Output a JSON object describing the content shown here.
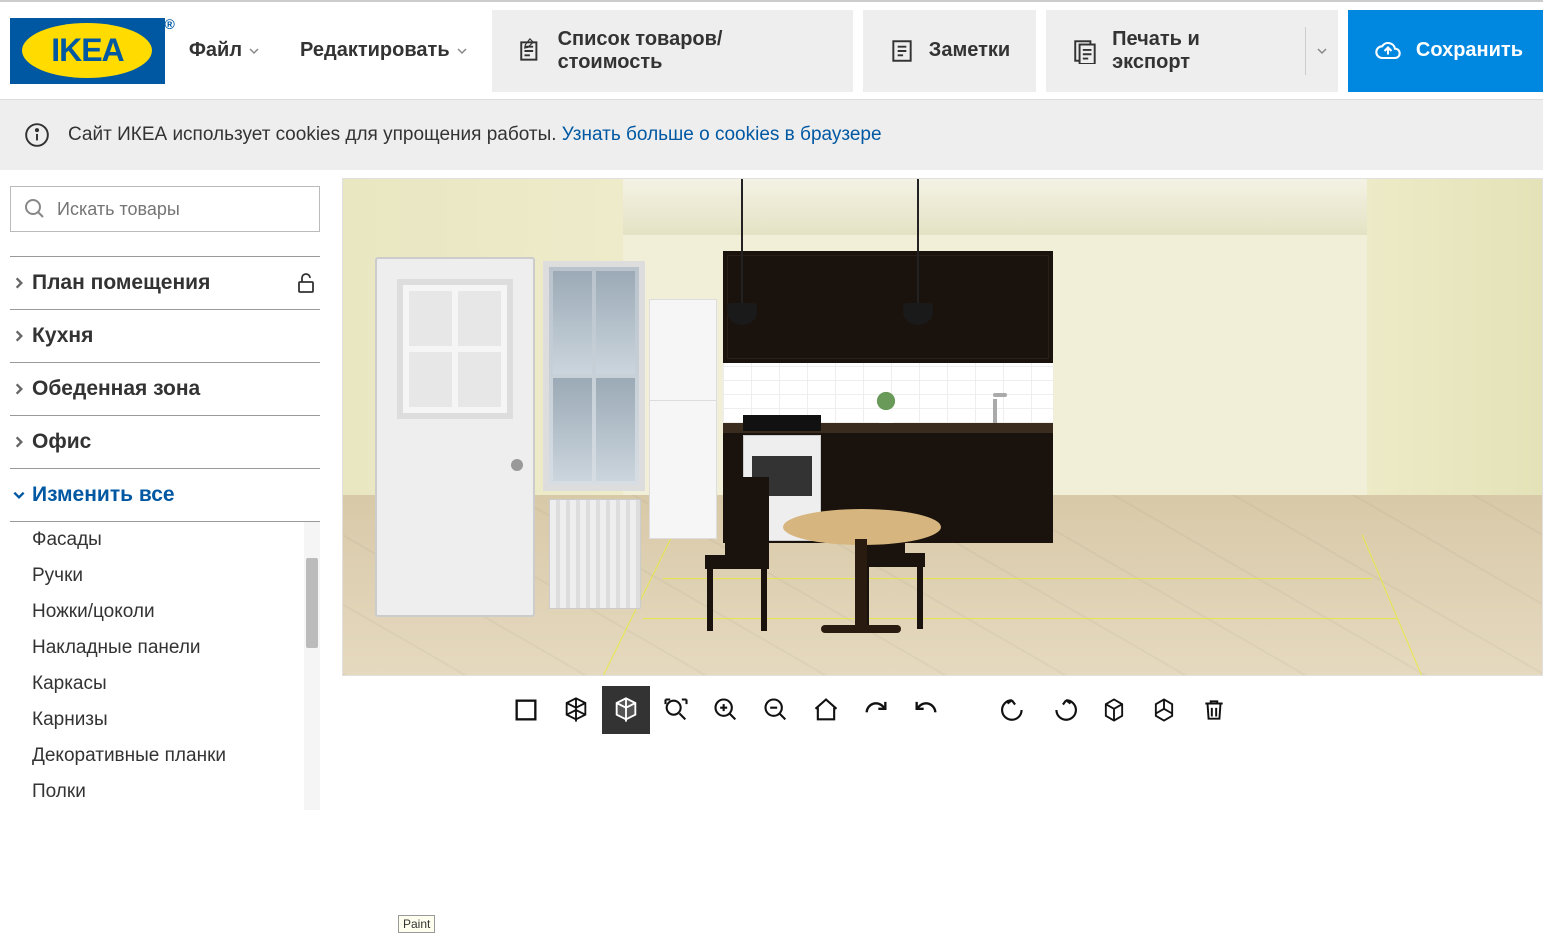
{
  "logo": {
    "text": "IKEA",
    "reg": "®"
  },
  "menus": {
    "file": "Файл",
    "edit": "Редактировать"
  },
  "toolbar": {
    "product_list": "Список товаров/стоимость",
    "notes": "Заметки",
    "print_export": "Печать и экспорт",
    "save": "Сохранить"
  },
  "cookie_bar": {
    "text": "Сайт ИКЕА использует cookies для упрощения работы. ",
    "link": "Узнать больше о cookies в браузере"
  },
  "search": {
    "placeholder": "Искать товары"
  },
  "sidebar": {
    "sections": [
      {
        "label": "План помещения",
        "locked": true
      },
      {
        "label": "Кухня"
      },
      {
        "label": "Обеденная зона"
      },
      {
        "label": "Офис"
      },
      {
        "label": "Изменить все",
        "active": true
      }
    ],
    "sub_items": [
      "Фасады",
      "Ручки",
      "Ножки/цоколи",
      "Накладные панели",
      "Каркасы",
      "Карнизы",
      "Декоративные планки",
      "Полки"
    ]
  },
  "tooltip": {
    "paint": "Paint"
  }
}
